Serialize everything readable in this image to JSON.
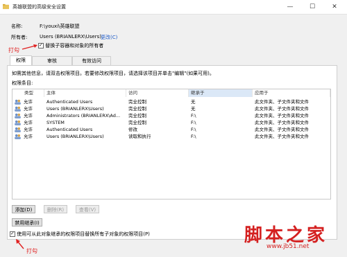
{
  "window": {
    "title": "英雄联盟的高级安全设置",
    "minimize_glyph": "—",
    "maximize_glyph": "☐",
    "close_glyph": "✕"
  },
  "name_row": {
    "label": "名称:",
    "value": "F:\\youxi\\英雄联盟"
  },
  "owner_row": {
    "label": "所有者:",
    "value": "Users (BRIANLERX\\Users)",
    "change_link": "更改(C)"
  },
  "replace_owner_checkbox": {
    "label": "替换子容器和对象的所有者",
    "checked": true
  },
  "annotation_top": "打勾",
  "annotation_bottom": "打勾",
  "tabs": [
    "权限",
    "审核",
    "有效访问"
  ],
  "info_text": "如需其他信息，请双击权限项目。若要修改权限项目，请选择该项目并单击\"编辑\"(如果可用)。",
  "entries_label": "权限条目:",
  "columns": [
    "类型",
    "主体",
    "访问",
    "继承于",
    "应用于"
  ],
  "rows": [
    {
      "type": "允许",
      "principal": "Authenticated Users",
      "access": "完全控制",
      "inherited": "无",
      "applies": "此文件夹、子文件夹和文件"
    },
    {
      "type": "允许",
      "principal": "Users (BRIANLERX\\Users)",
      "access": "完全控制",
      "inherited": "无",
      "applies": "此文件夹、子文件夹和文件"
    },
    {
      "type": "允许",
      "principal": "Administrators (BRIANLERX\\Ad...",
      "access": "完全控制",
      "inherited": "F:\\",
      "applies": "此文件夹、子文件夹和文件"
    },
    {
      "type": "允许",
      "principal": "SYSTEM",
      "access": "完全控制",
      "inherited": "F:\\",
      "applies": "此文件夹、子文件夹和文件"
    },
    {
      "type": "允许",
      "principal": "Authenticated Users",
      "access": "修改",
      "inherited": "F:\\",
      "applies": "此文件夹、子文件夹和文件"
    },
    {
      "type": "允许",
      "principal": "Users (BRIANLERX\\Users)",
      "access": "读取和执行",
      "inherited": "F:\\",
      "applies": "此文件夹、子文件夹和文件"
    }
  ],
  "buttons": {
    "add": "添加(D)",
    "remove": "删除(R)",
    "view": "查看(V)",
    "disable_inheritance": "禁用继承(I)"
  },
  "replace_child_checkbox": {
    "label": "使用可从此对象继承的权限项目替换所有子对象的权限项目(P)",
    "checked": true
  },
  "watermark": {
    "brand": "脚本之家",
    "url": "www.jb51.net"
  },
  "colors": {
    "accent": "#1b59c7",
    "annotation": "#e02020",
    "sorted_header": "#dbe8f7"
  }
}
